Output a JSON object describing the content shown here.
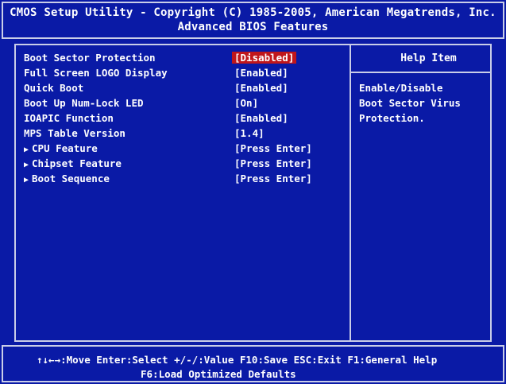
{
  "header": {
    "title": "CMOS Setup Utility - Copyright (C) 1985-2005, American Megatrends, Inc.",
    "subtitle": "Advanced BIOS Features"
  },
  "menu": [
    {
      "label": "Boot Sector Protection",
      "value": "[Disabled]",
      "selected": true
    },
    {
      "label": "Full Screen LOGO Display",
      "value": "[Enabled]"
    },
    {
      "label": "Quick Boot",
      "value": "[Enabled]"
    },
    {
      "label": "Boot Up Num-Lock LED",
      "value": "[On]"
    },
    {
      "label": "IOAPIC Function",
      "value": "[Enabled]"
    },
    {
      "label": "MPS Table Version",
      "value": "[1.4]"
    },
    {
      "label": "CPU Feature",
      "value": "[Press Enter]",
      "submenu": true
    },
    {
      "label": "Chipset Feature",
      "value": "[Press Enter]",
      "submenu": true
    },
    {
      "label": "Boot Sequence",
      "value": "[Press Enter]",
      "submenu": true
    }
  ],
  "help": {
    "title": "Help Item",
    "lines": [
      "Enable/Disable",
      "Boot Sector Virus",
      "Protection."
    ]
  },
  "footer": {
    "line1": "↑↓←→:Move   Enter:Select   +/-/:Value   F10:Save   ESC:Exit   F1:General Help",
    "line2": "F6:Load Optimized Defaults"
  },
  "colors": {
    "background": "#0a1aa6",
    "frame": "#c9cde8",
    "text": "#ffffff",
    "highlight": "#c0161b"
  },
  "icons": {
    "submenu": "triangle-right-icon"
  }
}
